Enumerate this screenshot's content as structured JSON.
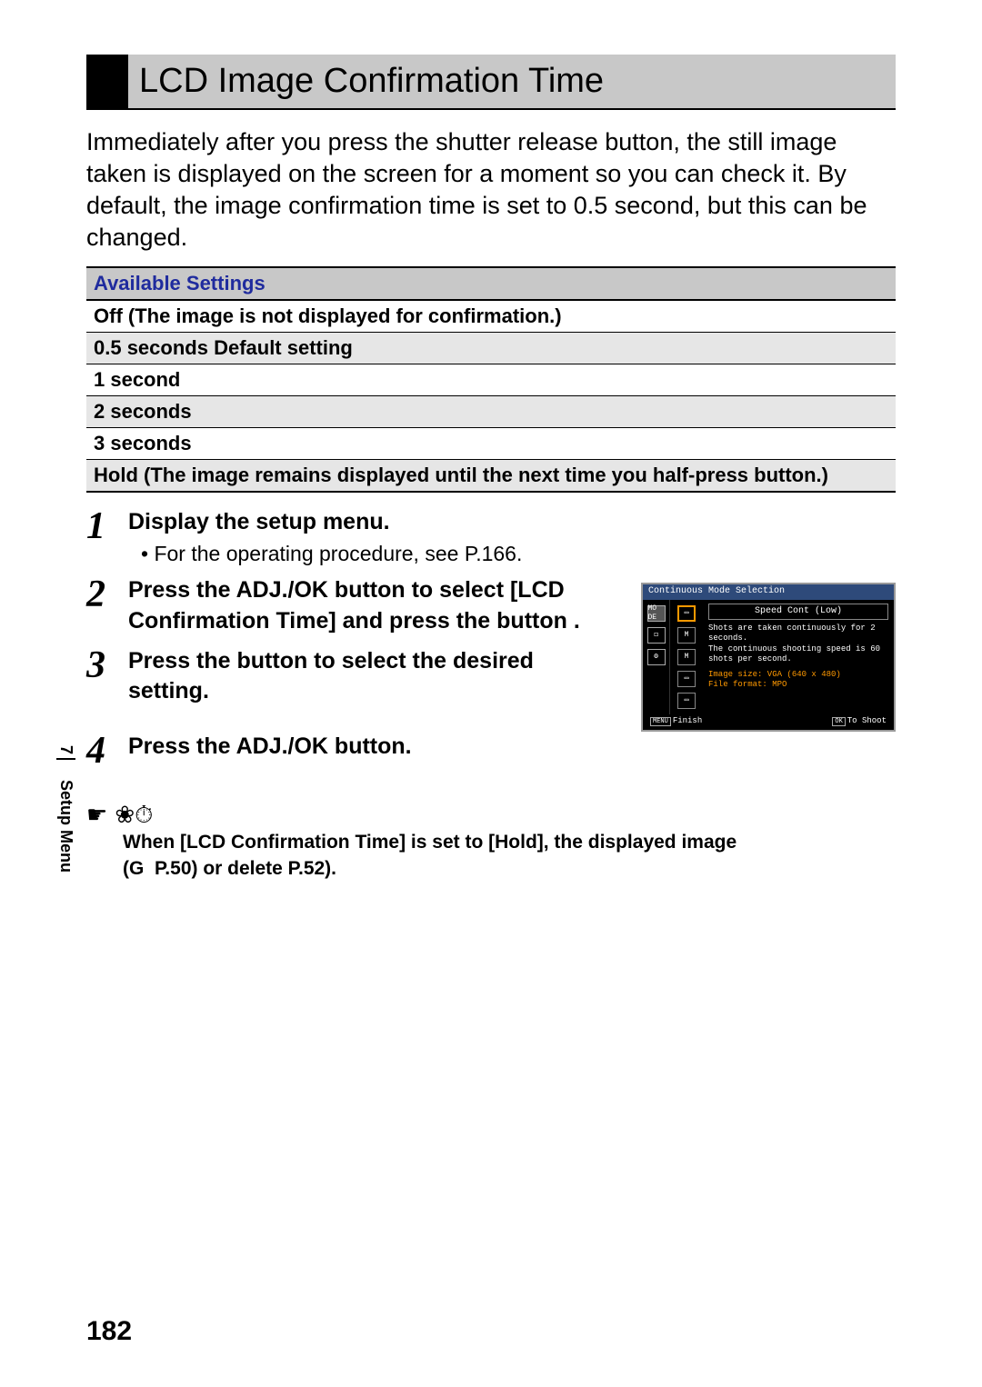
{
  "title": "LCD Image Confirmation Time",
  "intro": "Immediately after you press the shutter release button, the still image taken is displayed on the screen for a moment so you can check it. By default, the image confirmation time is set to 0.5 second, but this can be changed.",
  "settings_header": "Available Settings",
  "settings": [
    "Off (The image is not displayed for confirmation.)",
    "0.5 seconds Default setting",
    "1 second",
    "2 seconds",
    "3 seconds",
    "Hold (The image remains displayed until the next time you half-press button.)"
  ],
  "steps": [
    {
      "num": "1",
      "title": "Display the setup menu.",
      "sub": "• For the operating procedure, see P.166."
    },
    {
      "num": "2",
      "title": "Press the ADJ./OK button         to select [LCD Confirmation Time] and press the button      ."
    },
    {
      "num": "3",
      "title": "Press the button             to select the desired setting."
    },
    {
      "num": "4",
      "title": "Press the ADJ./OK button."
    }
  ],
  "lcd": {
    "header": "Continuous Mode Selection",
    "mode_title": "Speed Cont (Low)",
    "desc1": "Shots are taken continuously for 2 seconds.",
    "desc2": "The continuous shooting speed is 60 shots per second.",
    "info1": "Image size: VGA (640 x 480)",
    "info2": "File format: MPO",
    "menu_btn": "MENU",
    "menu_lbl": "Finish",
    "ok_btn": "OK",
    "ok_lbl": "To Shoot",
    "left_icons": [
      "MO DE",
      "◻",
      "⚙"
    ],
    "mid_icons": [
      "▭",
      "M",
      "M",
      "▭",
      "▭"
    ]
  },
  "note": {
    "main": "When [LCD Confirmation Time] is set to [Hold], the displayed image",
    "line2_a": "(G",
    "line2_b": "P.50) or delete P.52)."
  },
  "side": {
    "chapter": "7",
    "label": "Setup Menu"
  },
  "page_number": "182"
}
